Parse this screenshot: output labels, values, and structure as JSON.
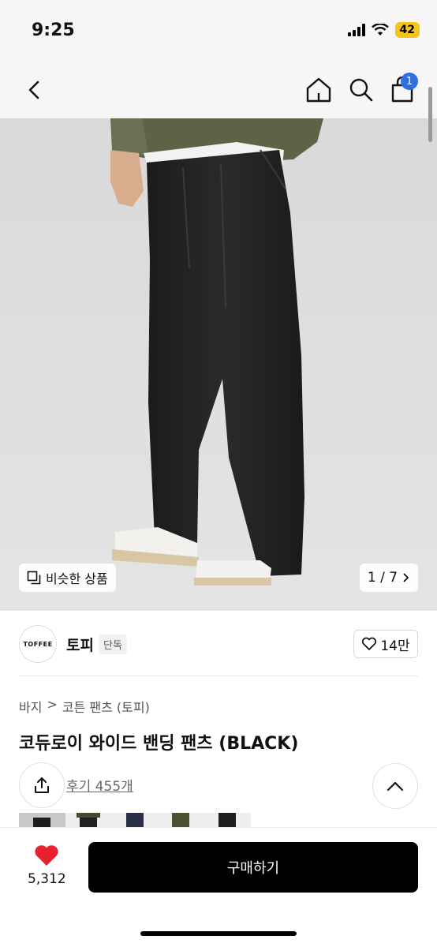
{
  "status_bar": {
    "time": "9:25",
    "battery": "42"
  },
  "nav": {
    "cart_count": "1"
  },
  "hero": {
    "similar_label": "비슷한 상품",
    "page_indicator": "1 / 7"
  },
  "brand": {
    "logo_text": "TOFFEE",
    "name": "토피",
    "tag": "단독",
    "likes": "14만"
  },
  "product": {
    "breadcrumb": [
      "바지",
      "코튼 팬츠 (토피)"
    ],
    "title": "코듀로이 와이드 밴딩 팬츠 (BLACK)",
    "review_link": "후기 455개"
  },
  "bottom": {
    "favorite_count": "5,312",
    "buy_label": "구매하기"
  },
  "colors": {
    "accent_red": "#e8212e",
    "badge_blue": "#2f6fe0",
    "buy_button": "#000000"
  },
  "thumbnails": [
    "black",
    "khaki-black",
    "navy",
    "olive",
    "dark"
  ]
}
